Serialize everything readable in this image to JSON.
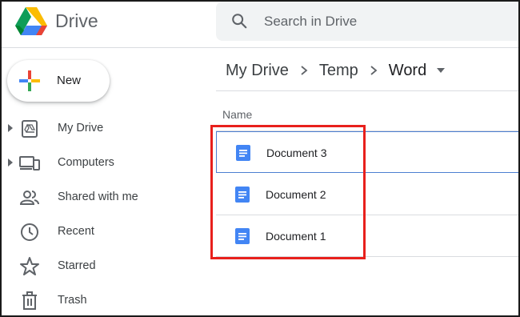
{
  "app": {
    "name": "Drive"
  },
  "search": {
    "placeholder": "Search in Drive"
  },
  "new_button": {
    "label": "New"
  },
  "sidebar": {
    "items": [
      {
        "label": "My Drive",
        "icon": "my-drive-icon",
        "expandable": true
      },
      {
        "label": "Computers",
        "icon": "computers-icon",
        "expandable": true
      },
      {
        "label": "Shared with me",
        "icon": "shared-icon",
        "expandable": false
      },
      {
        "label": "Recent",
        "icon": "clock-icon",
        "expandable": false
      },
      {
        "label": "Starred",
        "icon": "star-icon",
        "expandable": false
      },
      {
        "label": "Trash",
        "icon": "trash-icon",
        "expandable": false
      }
    ]
  },
  "breadcrumb": [
    "My Drive",
    "Temp",
    "Word"
  ],
  "file_list": {
    "column_header": "Name",
    "files": [
      {
        "name": "Document 3",
        "icon": "google-docs-icon",
        "selected": true
      },
      {
        "name": "Document 2",
        "icon": "google-docs-icon",
        "selected": false
      },
      {
        "name": "Document 1",
        "icon": "google-docs-icon",
        "selected": false
      }
    ]
  },
  "colors": {
    "accent_blue": "#4285f4",
    "highlight_red": "#e8201c",
    "selection_border": "#4d7fd1"
  }
}
